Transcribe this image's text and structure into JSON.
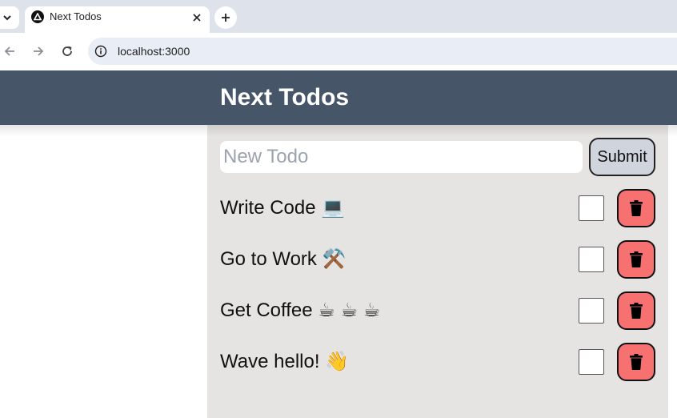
{
  "browser": {
    "tab_title": "Next Todos",
    "url": "localhost:3000"
  },
  "header": {
    "title": "Next Todos"
  },
  "form": {
    "placeholder": "New Todo",
    "submit_label": "Submit"
  },
  "todos": [
    {
      "text": "Write Code 💻",
      "completed": false
    },
    {
      "text": "Go to Work ⚒️",
      "completed": false
    },
    {
      "text": "Get Coffee ☕ ☕ ☕",
      "completed": false
    },
    {
      "text": "Wave hello! 👋",
      "completed": false
    }
  ],
  "colors": {
    "header_bg": "#475569",
    "panel_bg": "#e5e4e2",
    "delete_bg": "#f87171",
    "submit_bg": "#cfd4dd"
  }
}
